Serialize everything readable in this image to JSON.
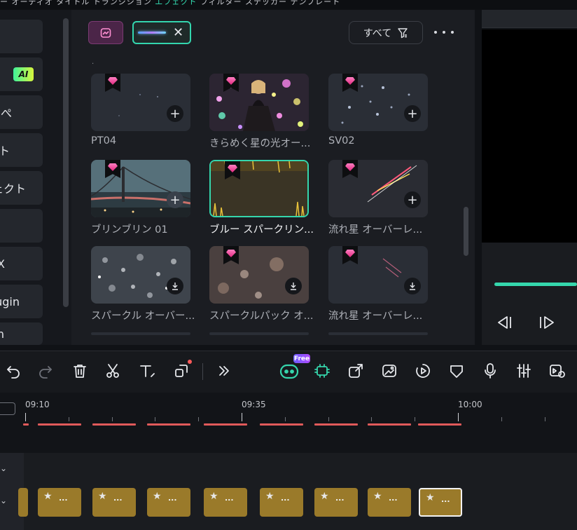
{
  "top_tabs": {
    "before": "ー オーディオ タイトル トランジション ",
    "active": "エフェクト",
    "after": " フィルター ステッカー テンプレート"
  },
  "sidebar": {
    "items": [
      {
        "label": ""
      },
      {
        "label": "",
        "badge": "AI"
      },
      {
        "label": "ぺ"
      },
      {
        "label": "ット"
      },
      {
        "label": "ェクト"
      },
      {
        "label": ""
      },
      {
        "label": "X"
      },
      {
        "label": "ugin"
      },
      {
        "label": "n"
      }
    ]
  },
  "browser": {
    "filter_label": "すべて",
    "cards": [
      {
        "label": "PT04"
      },
      {
        "label": "きらめく星の光オー..."
      },
      {
        "label": "SV02"
      },
      {
        "label": "ブリンブリン 01"
      },
      {
        "label": "ブルー スパークリン..."
      },
      {
        "label": "流れ星 オーバーレ..."
      },
      {
        "label": "スパークル オーバー..."
      },
      {
        "label": "スパークルパック オ..."
      },
      {
        "label": "流れ星 オーバーレ..."
      }
    ]
  },
  "toolbar": {
    "free_badge": "Free"
  },
  "timeline": {
    "ticks": [
      "09:10",
      "09:35",
      "10:00"
    ],
    "clip_label": "..."
  },
  "colors": {
    "accent": "#35d6ac",
    "clip": "#9a7a2a",
    "gem": "#e0287e"
  }
}
